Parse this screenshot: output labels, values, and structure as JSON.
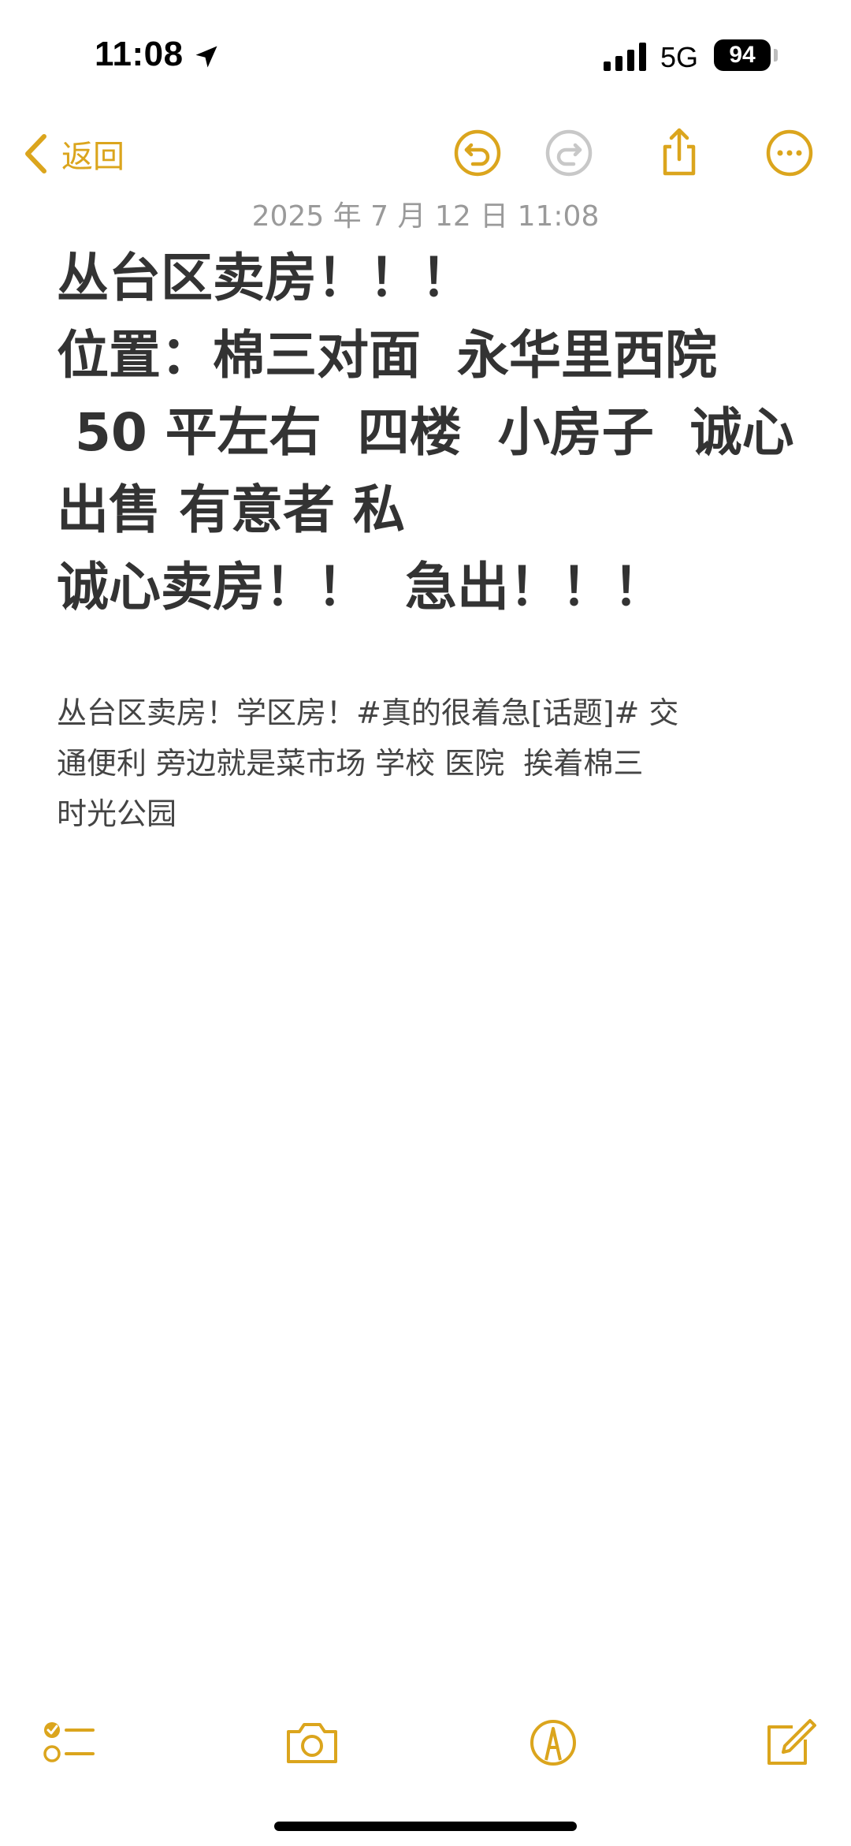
{
  "status_bar": {
    "time": "11:08",
    "network": "5G",
    "battery": "94"
  },
  "nav": {
    "back_label": "返回",
    "accent_color": "#dba51d"
  },
  "icons": {
    "back": "chevron-left-icon",
    "undo": "undo-icon",
    "redo": "redo-icon",
    "share": "share-icon",
    "more": "more-icon",
    "checklist": "checklist-icon",
    "camera": "camera-icon",
    "markup": "markup-icon",
    "compose": "compose-icon"
  },
  "note": {
    "date": "2025 年 7 月 12 日 11:08",
    "title_lines": [
      "丛台区卖房！！！",
      "位置：棉三对面  永华里西院",
      " 50 平左右  四楼  小房子  诚心",
      "出售 有意者 私",
      "诚心卖房！！  急出！！！"
    ],
    "body_lines": [
      "丛台区卖房！学区房！#真的很着急[话题]# 交",
      "通便利 旁边就是菜市场 学校 医院  挨着棉三",
      "时光公园"
    ]
  }
}
